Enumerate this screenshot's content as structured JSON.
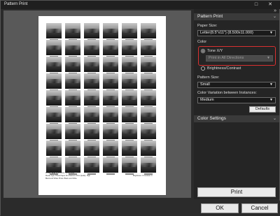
{
  "window": {
    "title": "Pattern Print",
    "restore_glyph": "□",
    "close_glyph": "✕"
  },
  "panel": {
    "collapse_glyph": "»",
    "section_title": "Pattern Print",
    "paper_size_label": "Paper Size:",
    "paper_size_value": "Letter(8.5\"x11\") (8.500x11.000)",
    "color_label": "Color",
    "tone_label": "Tone X/Y",
    "print_dir_value": "Print in All Directions",
    "brightness_label": "Brightness/Contrast",
    "pattern_size_label": "Pattern Size:",
    "pattern_size_value": "Small",
    "variation_label": "Color Variation between Instances:",
    "variation_value": "Medium",
    "defaults_button": "Defaults",
    "color_settings_title": "Color Settings",
    "print_button": "Print"
  },
  "footer": {
    "ok_button": "OK",
    "cancel_button": "Cancel"
  },
  "paper_footer": {
    "line1": "Printer: ELEI 1700 driver, 01-22-0021",
    "line2": "Media Type: Photo Paper Pro Platinum   Print Quality: High",
    "line3": "Black and White Photo: Black and White",
    "right": "Brightness: 0  Contrast: 0"
  },
  "colors": {
    "accent_red": "#d93030"
  }
}
